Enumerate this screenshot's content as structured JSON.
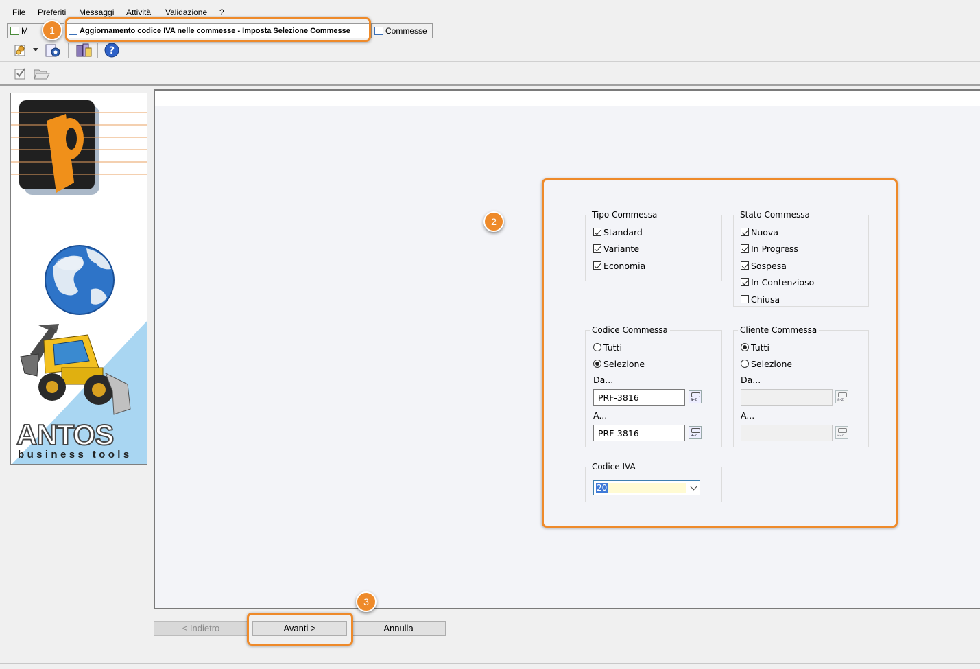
{
  "menu": [
    "File",
    "Preferiti",
    "Messaggi",
    "Attività",
    "Validazione",
    "?"
  ],
  "tabs": {
    "first": "M",
    "active": "Aggiornamento codice IVA nelle commesse - Imposta Selezione Commesse",
    "third": "Commesse"
  },
  "toolbar_icons": [
    "settings-wizard-icon",
    "gear-icon",
    "archive-icon",
    "help-icon",
    "checkbox-icon",
    "folder-open-icon"
  ],
  "branding": {
    "logo_top": "ANTOS",
    "logo_bottom": "business tools"
  },
  "form": {
    "tipo": {
      "title": "Tipo Commessa",
      "items": [
        {
          "label": "Standard",
          "checked": true
        },
        {
          "label": "Variante",
          "checked": true
        },
        {
          "label": "Economia",
          "checked": true
        }
      ]
    },
    "stato": {
      "title": "Stato Commessa",
      "items": [
        {
          "label": "Nuova",
          "checked": true
        },
        {
          "label": "In Progress",
          "checked": true
        },
        {
          "label": "Sospesa",
          "checked": true
        },
        {
          "label": "In Contenzioso",
          "checked": true
        },
        {
          "label": "Chiusa",
          "checked": false
        }
      ]
    },
    "codice": {
      "title": "Codice Commessa",
      "tutti": "Tutti",
      "selezione": "Selezione",
      "selected": "Selezione",
      "da_label": "Da...",
      "da_value": "PRF-3816",
      "a_label": "A...",
      "a_value": "PRF-3816"
    },
    "cliente": {
      "title": "Cliente Commessa",
      "tutti": "Tutti",
      "selezione": "Selezione",
      "selected": "Tutti",
      "da_label": "Da...",
      "da_value": "",
      "a_label": "A...",
      "a_value": ""
    },
    "iva": {
      "title": "Codice IVA",
      "value": "20"
    }
  },
  "buttons": {
    "back": "< Indietro",
    "next": "Avanti >",
    "cancel": "Annulla"
  },
  "callouts": [
    "1",
    "2",
    "3"
  ],
  "colors": {
    "accent": "#ee8a2a",
    "selection": "#3f7ad8",
    "combo_bg": "#fffbd3"
  }
}
